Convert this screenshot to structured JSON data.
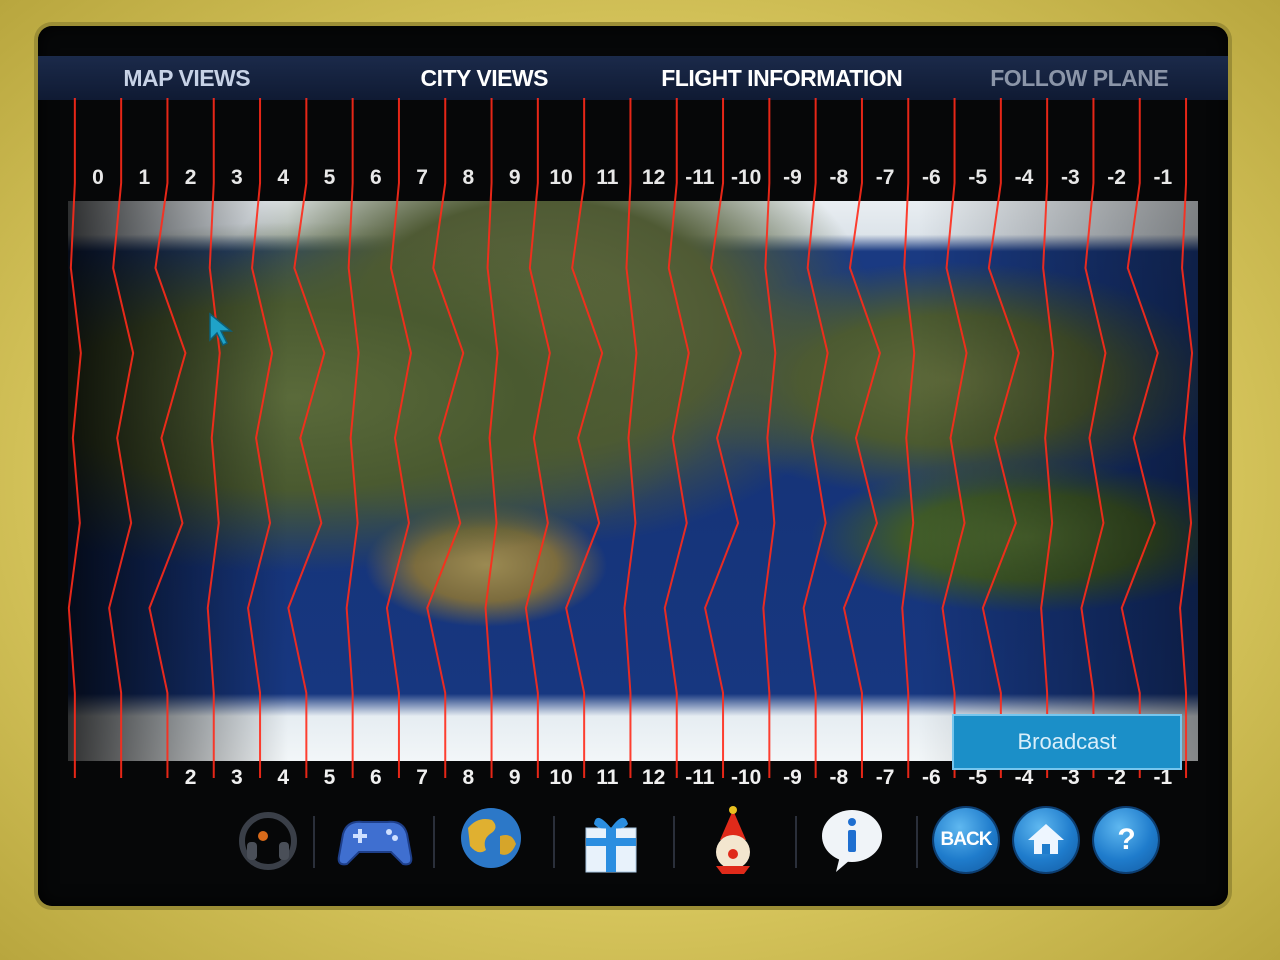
{
  "tabs": [
    {
      "label": "MAP VIEWS"
    },
    {
      "label": "CITY VIEWS"
    },
    {
      "label": "FLIGHT INFORMATION"
    },
    {
      "label": "FOLLOW PLANE"
    }
  ],
  "timezones_top": [
    "0",
    "1",
    "2",
    "3",
    "4",
    "5",
    "6",
    "7",
    "8",
    "9",
    "10",
    "11",
    "12",
    "-11",
    "-10",
    "-9",
    "-8",
    "-7",
    "-6",
    "-5",
    "-4",
    "-3",
    "-2",
    "-1"
  ],
  "timezones_bottom": [
    "2",
    "3",
    "4",
    "5",
    "6",
    "7",
    "8",
    "9",
    "10",
    "11",
    "12",
    "-11",
    "-10",
    "-9",
    "-8",
    "-7",
    "-6",
    "-5",
    "-4",
    "-3",
    "-2",
    "-1"
  ],
  "broadcast_label": "Broadcast",
  "toolbar": {
    "back_label": "BACK",
    "help_label": "?",
    "icons": [
      "headphones-icon",
      "gamepad-icon",
      "globe-icon",
      "gift-icon",
      "clown-icon",
      "info-icon"
    ]
  },
  "colors": {
    "zone_line": "#ff2a1a",
    "tab_bar": "#16233f",
    "broadcast_bg": "#1b8fc8",
    "round_button": "#1f7ccc"
  }
}
